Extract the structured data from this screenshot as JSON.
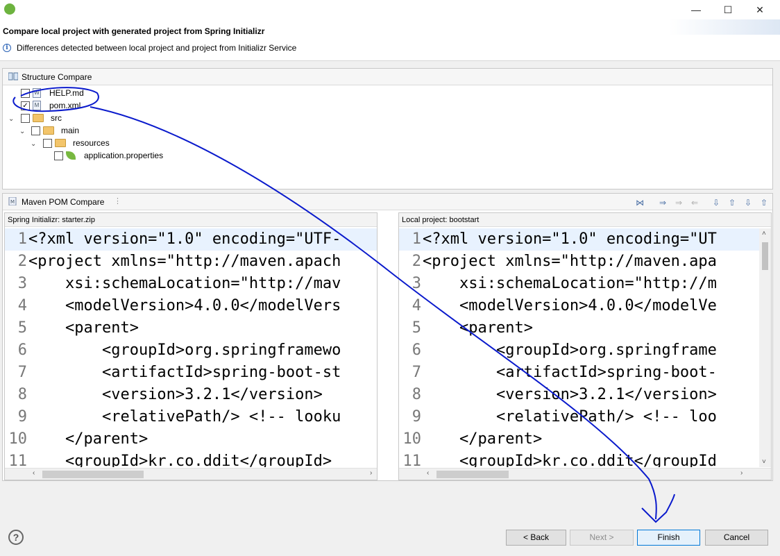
{
  "window": {
    "minimize_icon": "minimize-icon",
    "maximize_icon": "maximize-icon",
    "close_icon": "close-icon"
  },
  "header": {
    "title": "Compare local project with generated project from Spring Initializr",
    "message": "Differences detected between local project and project from Initializr Service"
  },
  "structure": {
    "title": "Structure Compare",
    "items": [
      {
        "label": "HELP.md",
        "checked": false
      },
      {
        "label": "pom.xml",
        "checked": true
      },
      {
        "label": "src",
        "checked": false
      },
      {
        "label": "main",
        "checked": false
      },
      {
        "label": "resources",
        "checked": false
      },
      {
        "label": "application.properties",
        "checked": false
      }
    ]
  },
  "pom_compare": {
    "title": "Maven POM Compare",
    "left_label": "Spring Initializr: starter.zip",
    "right_label": "Local project: bootstart"
  },
  "left_lines": [
    {
      "n": "1",
      "t": "<?xml version=\"1.0\" encoding=\"UTF-"
    },
    {
      "n": "2",
      "t": "<project xmlns=\"http://maven.apach"
    },
    {
      "n": "3",
      "t": "    xsi:schemaLocation=\"http://mav"
    },
    {
      "n": "4",
      "t": "    <modelVersion>4.0.0</modelVers"
    },
    {
      "n": "5",
      "t": "    <parent>"
    },
    {
      "n": "6",
      "t": "        <groupId>org.springframewo"
    },
    {
      "n": "7",
      "t": "        <artifactId>spring-boot-st"
    },
    {
      "n": "8",
      "t": "        <version>3.2.1</version>"
    },
    {
      "n": "9",
      "t": "        <relativePath/> <!-- looku"
    },
    {
      "n": "10",
      "t": "    </parent>"
    },
    {
      "n": "11",
      "t": "    <groupId>kr.co.ddit</groupId>"
    }
  ],
  "right_lines": [
    {
      "n": "1",
      "t": "<?xml version=\"1.0\" encoding=\"UT"
    },
    {
      "n": "2",
      "t": "<project xmlns=\"http://maven.apa"
    },
    {
      "n": "3",
      "t": "    xsi:schemaLocation=\"http://m"
    },
    {
      "n": "4",
      "t": "    <modelVersion>4.0.0</modelVe"
    },
    {
      "n": "5",
      "t": "    <parent>"
    },
    {
      "n": "6",
      "t": "        <groupId>org.springframe"
    },
    {
      "n": "7",
      "t": "        <artifactId>spring-boot-"
    },
    {
      "n": "8",
      "t": "        <version>3.2.1</version>"
    },
    {
      "n": "9",
      "t": "        <relativePath/> <!-- loo"
    },
    {
      "n": "10",
      "t": "    </parent>"
    },
    {
      "n": "11",
      "t": "    <groupId>kr.co.ddit</groupId"
    }
  ],
  "buttons": {
    "back": "< Back",
    "next": "Next >",
    "finish": "Finish",
    "cancel": "Cancel",
    "help": "?"
  }
}
